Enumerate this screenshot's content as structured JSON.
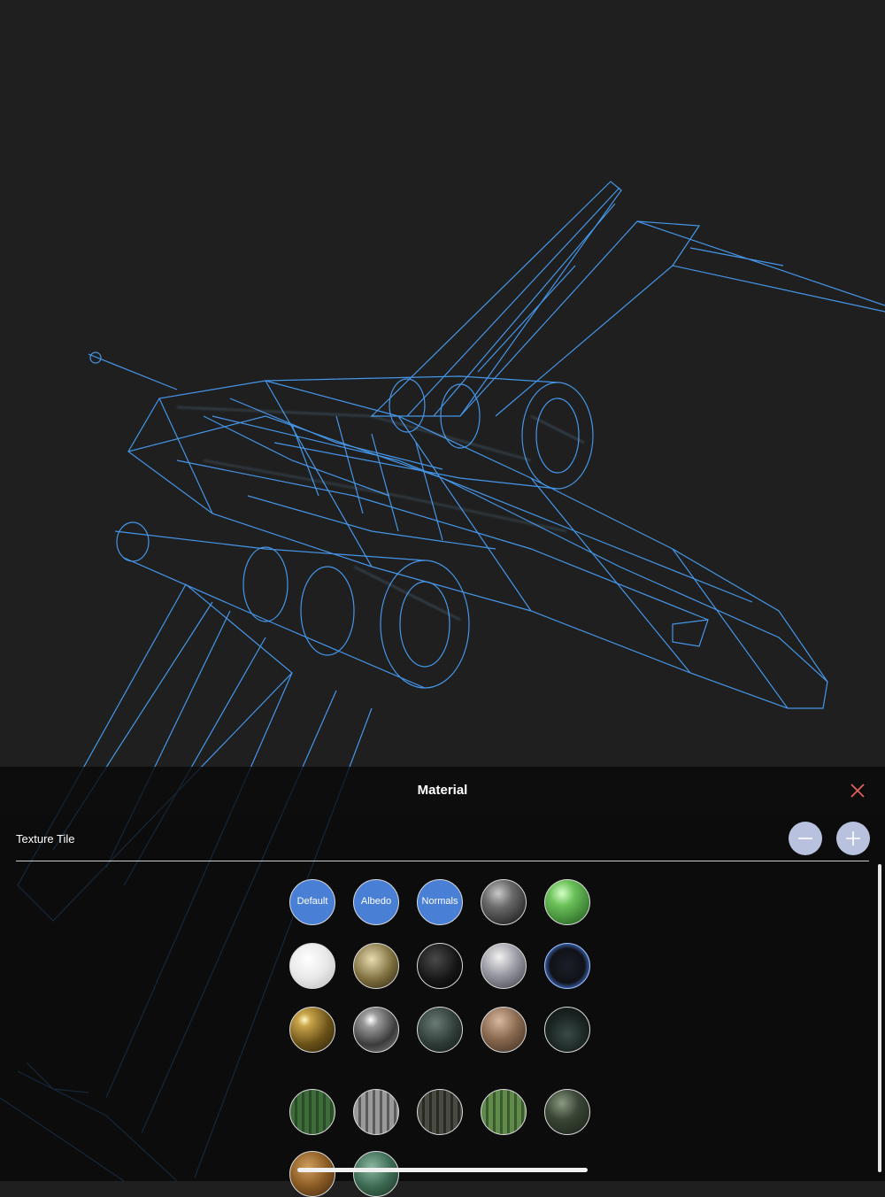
{
  "panel": {
    "title": "Material",
    "texture_tile_label": "Texture Tile"
  },
  "icons": {
    "close": "close-icon",
    "minus": "minus-icon",
    "plus": "plus-icon"
  },
  "colors": {
    "wireframe": "#4aa3ff",
    "close": "#e0625a",
    "stepper": "#b8c2de",
    "selected_chip": "#4a7fd6"
  },
  "materials": [
    {
      "label": "Default",
      "name": "default"
    },
    {
      "label": "Albedo",
      "name": "albedo"
    },
    {
      "label": "Normals",
      "name": "normals"
    },
    {
      "label": "",
      "name": "grey-metal"
    },
    {
      "label": "",
      "name": "green-plastic"
    },
    {
      "label": "",
      "name": "white-speckle"
    },
    {
      "label": "",
      "name": "gold-speckle"
    },
    {
      "label": "",
      "name": "black-speckle"
    },
    {
      "label": "",
      "name": "brushed-silver"
    },
    {
      "label": "",
      "name": "dark-glass"
    },
    {
      "label": "",
      "name": "gold"
    },
    {
      "label": "",
      "name": "chrome"
    },
    {
      "label": "",
      "name": "dark-marble"
    },
    {
      "label": "",
      "name": "wood"
    },
    {
      "label": "",
      "name": "dark-green-glass"
    },
    {
      "label": "",
      "name": "green-stripes"
    },
    {
      "label": "",
      "name": "grey-stripes"
    },
    {
      "label": "",
      "name": "dark-stripes"
    },
    {
      "label": "",
      "name": "olive-stripes"
    },
    {
      "label": "",
      "name": "dark-olive"
    },
    {
      "label": "",
      "name": "rust"
    },
    {
      "label": "",
      "name": "green-stone"
    }
  ]
}
